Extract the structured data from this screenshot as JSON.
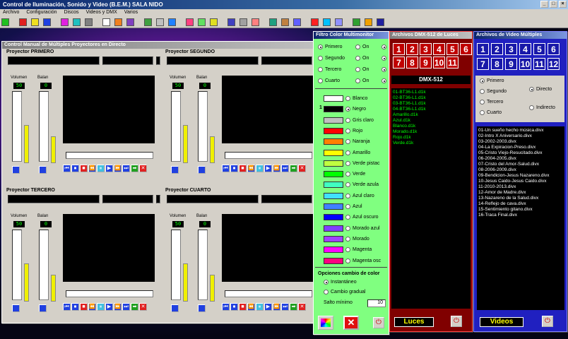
{
  "app": {
    "title": "Control de Iluminación, Sonido y Video (B.E.M.)  SALA NIDO"
  },
  "menu": [
    "Archivo",
    "Configuración",
    "Discos",
    "Videos y DMX",
    "Varios"
  ],
  "manual": {
    "title": "Control Manual de Múltiples Proyectores en Directo",
    "volumen": "Volumen",
    "balance": "Balan",
    "projectors": [
      {
        "name": "Proyector PRIMERO",
        "vol": "50",
        "bal": "0"
      },
      {
        "name": "Proyector SEGUNDO",
        "vol": "50",
        "bal": "0"
      },
      {
        "name": "Proyector TERCERO",
        "vol": "50",
        "bal": "0"
      },
      {
        "name": "Proyector CUARTO",
        "vol": "50",
        "bal": "0"
      }
    ]
  },
  "filtro": {
    "title": "Filtro Color Multimonitor",
    "projectors": [
      "Primero",
      "Segundo",
      "Tercero",
      "Cuarto"
    ],
    "on": "On",
    "marker": "1",
    "colors": [
      {
        "name": "Blanco",
        "hex": "#ffffff"
      },
      {
        "name": "Negro",
        "hex": "#000000"
      },
      {
        "name": "Gris claro",
        "hex": "#c0c0c0"
      },
      {
        "name": "Rojo",
        "hex": "#ff0000"
      },
      {
        "name": "Naranja",
        "hex": "#ff8000"
      },
      {
        "name": "Amarillo",
        "hex": "#ffff00"
      },
      {
        "name": "Verde pistac",
        "hex": "#c0ff40"
      },
      {
        "name": "Verde",
        "hex": "#00ff00"
      },
      {
        "name": "Verde azula",
        "hex": "#40ffc0"
      },
      {
        "name": "Azul claro",
        "hex": "#40e0ff"
      },
      {
        "name": "Azul",
        "hex": "#4080ff"
      },
      {
        "name": "Azul oscuro",
        "hex": "#0000ff"
      },
      {
        "name": "Morado azul",
        "hex": "#8040ff"
      },
      {
        "name": "Morado",
        "hex": "#a040ff"
      },
      {
        "name": "Magenta",
        "hex": "#ff00ff"
      },
      {
        "name": "Magenta osc",
        "hex": "#ff0080"
      }
    ],
    "opts_title": "Opciones cambio de color",
    "instant": "Instantáneo",
    "gradual": "Cambio gradual",
    "salto": "Salto mínimo",
    "salto_val": "10"
  },
  "dmx": {
    "title": "Archivos DMX-512 de Luces",
    "nums": [
      "1",
      "2",
      "3",
      "4",
      "5",
      "6",
      "7",
      "8",
      "9",
      "10",
      "11"
    ],
    "header": "DMX-512",
    "files": [
      "01-BT36-L1.d1k",
      "02-BT36-L1.d1k",
      "03-BT36-L1.d1k",
      "04-BT36-L1.d1k",
      "Amarillo.d1k",
      "Azul.d1k",
      "Blanco.d1k",
      "Morado.d1k",
      "Rojo.d1k",
      "Verde.d1k"
    ],
    "luces": "Luces"
  },
  "videos": {
    "title": "Archivos de Video  Múltiples",
    "nums": [
      "1",
      "2",
      "3",
      "4",
      "5",
      "6",
      "7",
      "8",
      "9",
      "10",
      "11",
      "12"
    ],
    "proj": [
      "Primero",
      "Segundo",
      "Tercero",
      "Cuarto"
    ],
    "directo": "Directo",
    "indirecto": "Indirecto",
    "files": [
      "01-Un sueño hecho música.divx",
      "02-Intro X Aniversario.divx",
      "03-2002-2003.divx",
      "04-La Expiracion-Preso.divx",
      "05-Cristo Viejo-Resucitado.divx",
      "06-2004-2005.divx",
      "07-Cristo del Amor-Salud.divx",
      "08-2006-2009.divx",
      "09-Bendicion-Jesus Nazareno.divx",
      "10-Jesus Caido-Jesus Caido.divx",
      "11-2010-2013.divx",
      "12-Amor de Madre.divx",
      "13-Nazareno de la Salud.divx",
      "14-Reflejo de cava.divx",
      "15-Sentimiento gitano.divx",
      "16-Traca Final.divx"
    ],
    "label": "Videos"
  }
}
